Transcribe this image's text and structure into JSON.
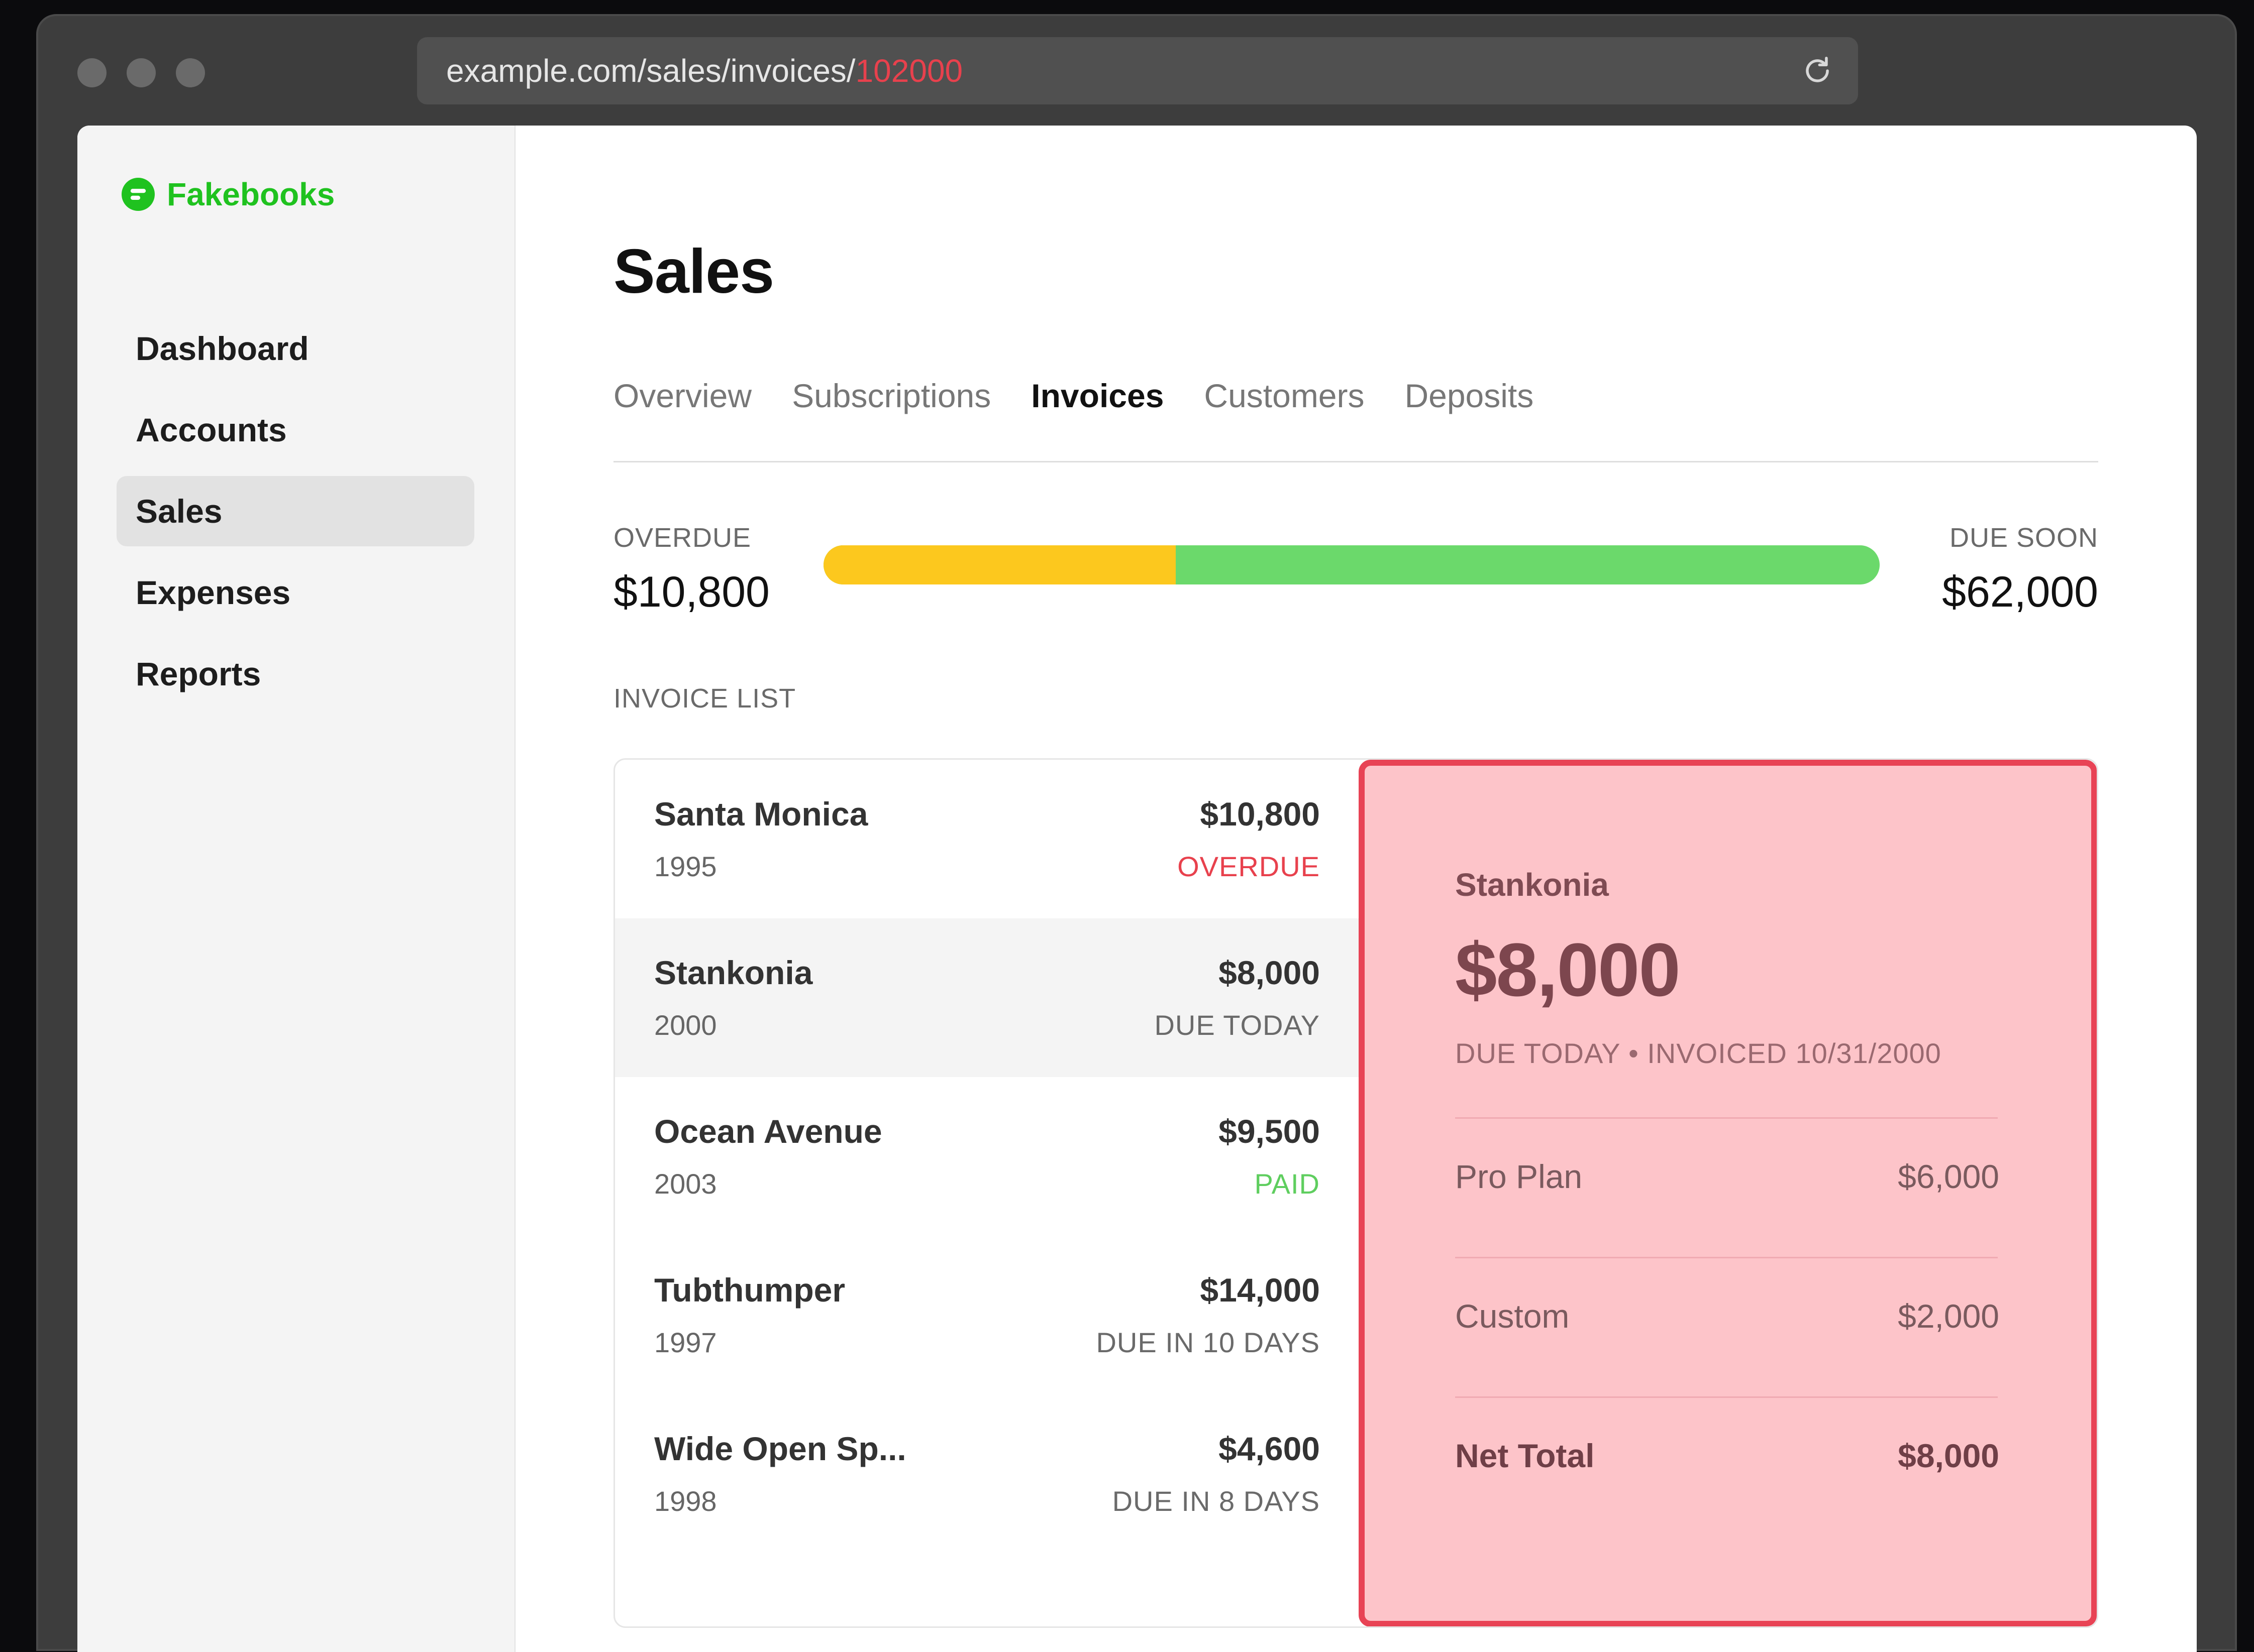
{
  "browser": {
    "url_base": "example.com/sales/invoices/",
    "url_id": "102000"
  },
  "app": {
    "brand": "Fakebooks",
    "brand_color": "#1fc21f"
  },
  "sidebar": {
    "items": [
      {
        "label": "Dashboard",
        "active": false
      },
      {
        "label": "Accounts",
        "active": false
      },
      {
        "label": "Sales",
        "active": true
      },
      {
        "label": "Expenses",
        "active": false
      },
      {
        "label": "Reports",
        "active": false
      }
    ]
  },
  "page": {
    "title": "Sales",
    "tabs": [
      {
        "label": "Overview",
        "active": false
      },
      {
        "label": "Subscriptions",
        "active": false
      },
      {
        "label": "Invoices",
        "active": true
      },
      {
        "label": "Customers",
        "active": false
      },
      {
        "label": "Deposits",
        "active": false
      }
    ]
  },
  "summary": {
    "overdue_label": "OVERDUE",
    "overdue_value": "$10,800",
    "due_soon_label": "DUE SOON",
    "due_soon_value": "$62,000",
    "overdue_fraction": 0.3333,
    "overdue_color": "#fcc81e",
    "due_soon_color": "#6bd96b"
  },
  "invoices": {
    "section_label": "INVOICE LIST",
    "rows": [
      {
        "name": "Santa Monica",
        "year": "1995",
        "amount": "$10,800",
        "status": "OVERDUE",
        "status_color": "#e8414d"
      },
      {
        "name": "Stankonia",
        "year": "2000",
        "amount": "$8,000",
        "status": "DUE TODAY",
        "status_color": "#6a6a6a"
      },
      {
        "name": "Ocean Avenue",
        "year": "2003",
        "amount": "$9,500",
        "status": "PAID",
        "status_color": "#5fce5f"
      },
      {
        "name": "Tubthumper",
        "year": "1997",
        "amount": "$14,000",
        "status": "DUE IN 10 DAYS",
        "status_color": "#6a6a6a"
      },
      {
        "name": "Wide Open Sp...",
        "year": "1998",
        "amount": "$4,600",
        "status": "DUE IN 8 DAYS",
        "status_color": "#6a6a6a"
      }
    ]
  },
  "detail": {
    "customer": "Stankonia",
    "amount": "$8,000",
    "meta": "DUE TODAY • INVOICED 10/31/2000",
    "lines": [
      {
        "label": "Pro Plan",
        "value": "$6,000"
      },
      {
        "label": "Custom",
        "value": "$2,000"
      }
    ],
    "total_label": "Net Total",
    "total_value": "$8,000",
    "highlight_color": "#e84355"
  }
}
